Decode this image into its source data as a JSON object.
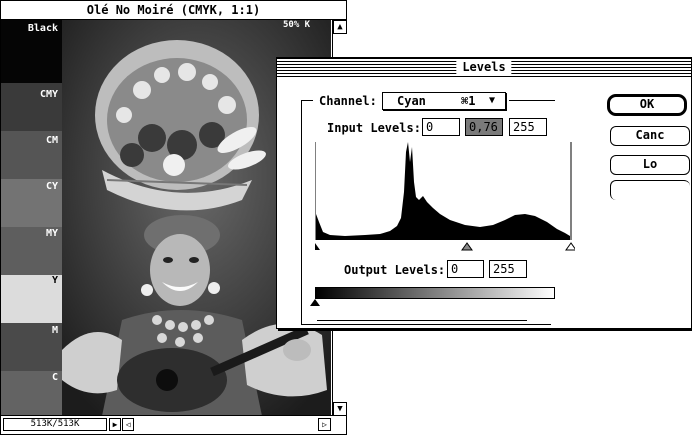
{
  "image_window": {
    "title": "Olé No Moiré  (CMYK, 1:1)",
    "corner_label": "50% K",
    "status": "513K/513K",
    "swatches": [
      {
        "label": "Black",
        "color": "#050505"
      },
      {
        "label": "CMY",
        "color": "#3a3a3a"
      },
      {
        "label": "CM",
        "color": "#555555"
      },
      {
        "label": "CY",
        "color": "#737373"
      },
      {
        "label": "MY",
        "color": "#5e5e5e"
      },
      {
        "label": "Y",
        "color": "#dcdcdc"
      },
      {
        "label": "M",
        "color": "#4a4a4a"
      },
      {
        "label": "C",
        "color": "#636363"
      }
    ]
  },
  "levels_dialog": {
    "title": "Levels",
    "channel_label": "Channel:",
    "channel_value": "Cyan",
    "channel_shortcut": "⌘1",
    "input_levels_label": "Input Levels:",
    "input_black": "0",
    "input_gamma": "0,76",
    "input_white": "255",
    "output_levels_label": "Output Levels:",
    "output_black": "0",
    "output_white": "255",
    "buttons": {
      "ok": "OK",
      "cancel": "Canc",
      "load": "Lo"
    }
  }
}
